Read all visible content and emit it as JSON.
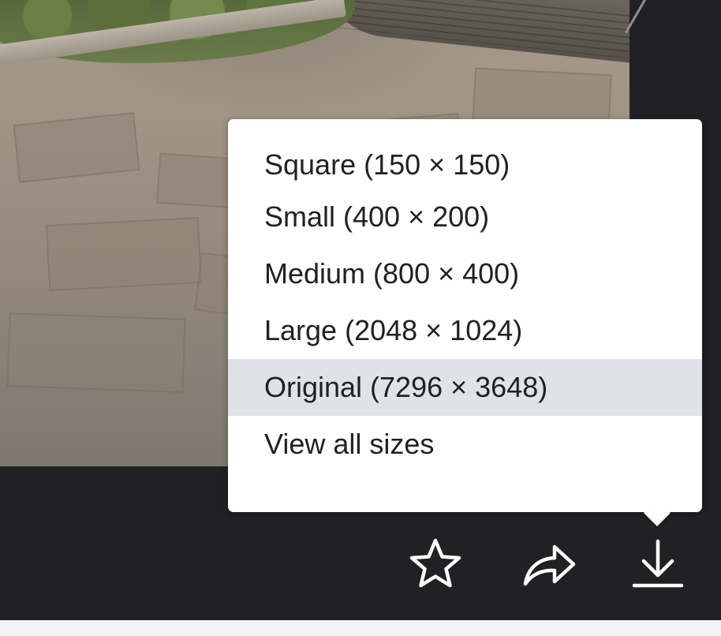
{
  "download_menu": {
    "items": [
      {
        "label": "Square (150 × 150)"
      },
      {
        "label": "Small (400 × 200)"
      },
      {
        "label": "Medium (800 × 400)"
      },
      {
        "label": "Large (2048 × 1024)"
      },
      {
        "label": "Original (7296 × 3648)",
        "highlighted": true
      },
      {
        "label": "View all sizes"
      }
    ]
  },
  "actions": {
    "icons": [
      "star-icon",
      "share-icon",
      "download-icon"
    ]
  },
  "colors": {
    "background": "#212124",
    "menu_background": "#ffffff",
    "menu_highlight": "#dfe3e7",
    "text": "#212124",
    "icon": "#ffffff"
  }
}
